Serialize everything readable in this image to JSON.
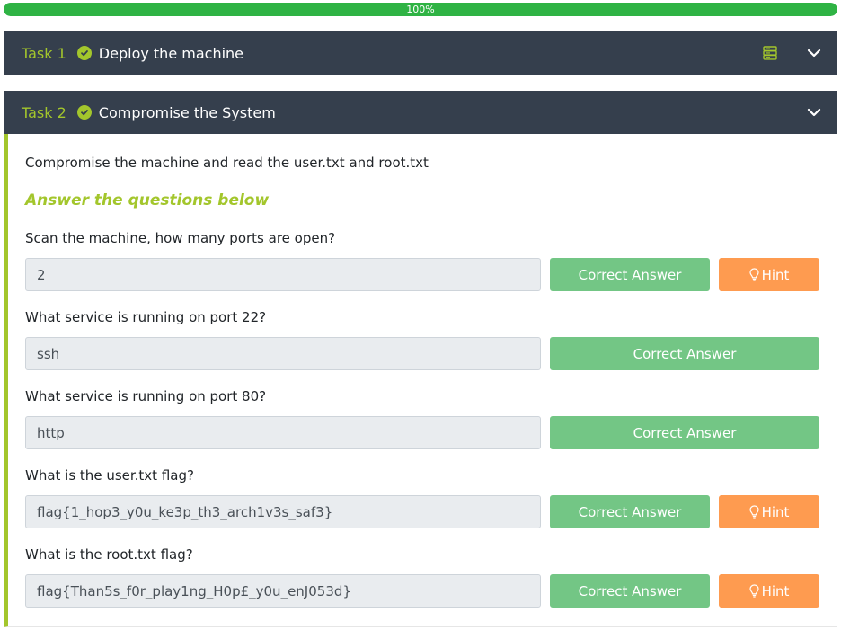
{
  "progress": {
    "label": "100%",
    "value": 1.0
  },
  "colors": {
    "accent": "#a3c62c",
    "header_bg": "#353f4d",
    "correct": "#73c685",
    "hint": "#fe9b50",
    "progress": "#2fb344"
  },
  "tasks": [
    {
      "number": "Task 1",
      "title": "Deploy the machine",
      "icons": [
        "check-circle-icon",
        "server-icon",
        "chevron-down-icon"
      ]
    },
    {
      "number": "Task 2",
      "title": "Compromise the System",
      "icons": [
        "check-circle-icon",
        "chevron-down-icon"
      ]
    }
  ],
  "task2": {
    "description": "Compromise the machine and read the user.txt and root.txt",
    "answer_heading": "Answer the questions below",
    "correct_label": "Correct Answer",
    "hint_label": "Hint",
    "questions": [
      {
        "text": "Scan the machine, how many ports are open?",
        "answer": "2",
        "has_hint": true
      },
      {
        "text": "What service is running on port 22?",
        "answer": "ssh",
        "has_hint": false
      },
      {
        "text": "What service is running on port 80?",
        "answer": "http",
        "has_hint": false
      },
      {
        "text": "What is the user.txt flag?",
        "answer": "flag{1_hop3_y0u_ke3p_th3_arch1v3s_saf3}",
        "has_hint": true
      },
      {
        "text": "What is the root.txt flag?",
        "answer": "flag{Than5s_f0r_play1ng_H0p£_y0u_enJ053d}",
        "has_hint": true
      }
    ]
  }
}
